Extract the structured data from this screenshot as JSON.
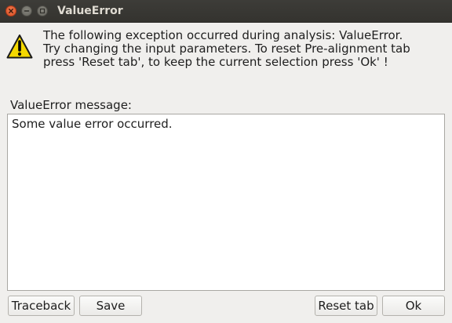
{
  "window": {
    "title": "ValueError"
  },
  "dialog": {
    "message_lines": [
      "The following exception occurred during analysis: ValueError.",
      "Try changing the input parameters. To reset Pre-alignment tab",
      "press 'Reset tab', to keep the current selection press 'Ok' !"
    ],
    "field_label": "ValueError message:",
    "details_text": "Some value error occurred.",
    "icon": "warning-icon",
    "warning_color": "#f5d800"
  },
  "buttons": {
    "traceback": "Traceback",
    "save": "Save",
    "reset_tab": "Reset tab",
    "ok": "Ok"
  }
}
